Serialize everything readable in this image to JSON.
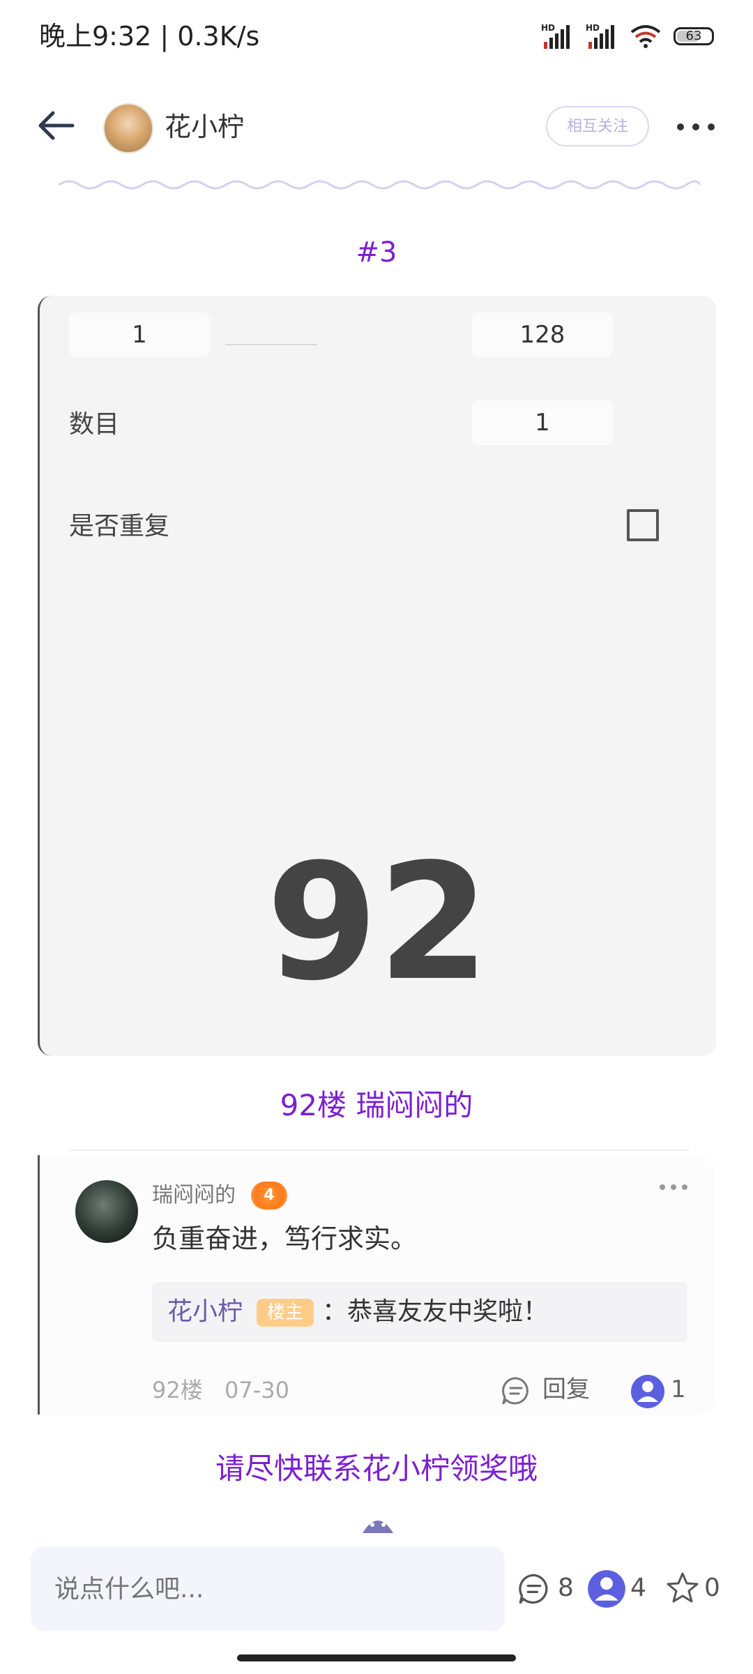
{
  "status_bar": {
    "time_speed": "晚上9:32 | 0.3K/s",
    "signal_label_1": "HD",
    "signal_label_2": "HD",
    "battery_level": "63",
    "icons": [
      "signal-hd-icon",
      "signal-hd-icon",
      "wifi-icon",
      "battery-icon"
    ]
  },
  "header": {
    "back_icon": "arrow-left-icon",
    "author_name": "花小柠",
    "follow_label": "相互关注",
    "more_icon": "more-dots-icon"
  },
  "post": {
    "floor_tag": "#3",
    "randomizer": {
      "min_value": "1",
      "max_value": "128",
      "count_label": "数目",
      "count_value": "1",
      "repeat_label": "是否重复",
      "repeat_checked": false,
      "result": "92"
    },
    "winner_title": "92楼 瑞闷闷的",
    "contact_note": "请尽快联系花小柠领奖哦"
  },
  "comment": {
    "username": "瑞闷闷的",
    "level": "4",
    "text": "负重奋进，笃行求实。",
    "quote_author": "花小柠",
    "quote_badge": "楼主",
    "quote_text": "：恭喜友友中奖啦！",
    "floor": "92楼",
    "date": "07-30",
    "reply_label": "回复",
    "like_count": "1"
  },
  "bottom_bar": {
    "input_placeholder": "说点什么吧...",
    "comment_count": "8",
    "like_count": "4",
    "star_count": "0"
  },
  "colors": {
    "accent_purple": "#7b1fd1",
    "like_blue": "#5b5fe0",
    "badge_orange": "#ff7a1a",
    "lz_badge": "#ffcc88"
  }
}
